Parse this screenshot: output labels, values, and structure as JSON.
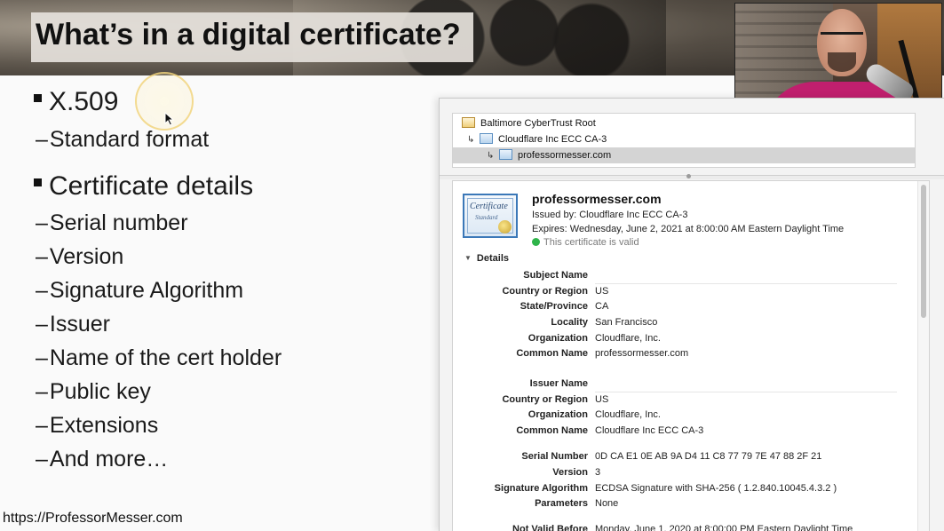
{
  "slide": {
    "title": "What’s in a digital certificate?",
    "bullets": [
      {
        "level": 1,
        "text": "X.509"
      },
      {
        "level": 2,
        "text": "Standard format"
      },
      {
        "level": 1,
        "text": "Certificate details"
      },
      {
        "level": 2,
        "text": "Serial number"
      },
      {
        "level": 2,
        "text": "Version"
      },
      {
        "level": 2,
        "text": "Signature Algorithm"
      },
      {
        "level": 2,
        "text": "Issuer"
      },
      {
        "level": 2,
        "text": "Name of the cert holder"
      },
      {
        "level": 2,
        "text": "Public key"
      },
      {
        "level": 2,
        "text": "Extensions"
      },
      {
        "level": 2,
        "text": "And more…"
      }
    ],
    "footer_url": "https://ProfessorMesser.com"
  },
  "cert_viewer": {
    "chain": [
      {
        "label": "Baltimore CyberTrust Root",
        "depth": 0,
        "selected": false
      },
      {
        "label": "Cloudflare Inc ECC CA-3",
        "depth": 1,
        "selected": false
      },
      {
        "label": "professormesser.com",
        "depth": 2,
        "selected": true
      }
    ],
    "summary": {
      "name": "professormesser.com",
      "issued_by": "Issued by: Cloudflare Inc ECC CA-3",
      "expires": "Expires: Wednesday, June 2, 2021 at 8:00:00 AM Eastern Daylight Time",
      "validity": "This certificate is valid",
      "icon_word_1": "Certificate",
      "icon_word_2": "Standard"
    },
    "details_label": "Details",
    "fields": [
      {
        "label": "Subject Name",
        "value": "",
        "header": true
      },
      {
        "label": "Country or Region",
        "value": "US"
      },
      {
        "label": "State/Province",
        "value": "CA"
      },
      {
        "label": "Locality",
        "value": "San Francisco"
      },
      {
        "label": "Organization",
        "value": "Cloudflare, Inc."
      },
      {
        "label": "Common Name",
        "value": "professormesser.com"
      },
      {
        "label": "Issuer Name",
        "value": "",
        "header": true
      },
      {
        "label": "Country or Region",
        "value": "US"
      },
      {
        "label": "Organization",
        "value": "Cloudflare, Inc."
      },
      {
        "label": "Common Name",
        "value": "Cloudflare Inc ECC CA-3"
      },
      {
        "label": "Serial Number",
        "value": "0D CA E1 0E AB 9A D4 11 C8 77 79 7E 47 88 2F 21"
      },
      {
        "label": "Version",
        "value": "3"
      },
      {
        "label": "Signature Algorithm",
        "value": "ECDSA Signature with SHA-256 ( 1.2.840.10045.4.3.2 )"
      },
      {
        "label": "Parameters",
        "value": "None"
      },
      {
        "label": "Not Valid Before",
        "value": "Monday, June 1, 2020 at 8:00:00 PM Eastern Daylight Time"
      }
    ]
  },
  "icons": {
    "cursor": "mouse-pointer-icon",
    "chain_cert": "certificate-icon",
    "root_cert": "root-certificate-icon",
    "valid": "valid-check-icon",
    "disclosure": "disclosure-triangle-icon"
  },
  "colors": {
    "valid_green": "#2fb44a",
    "selected_row": "#d4d4d4",
    "title_bar_bg": "#e4e0da"
  }
}
